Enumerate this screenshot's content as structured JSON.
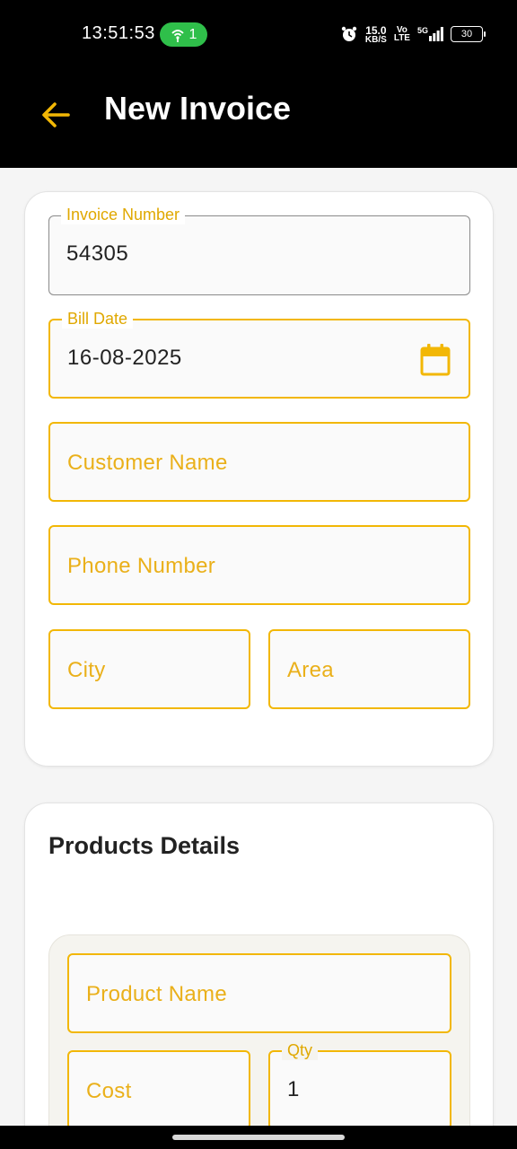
{
  "status_bar": {
    "time": "13:51:53",
    "hotspot_count": "1",
    "net_speed_value": "15.0",
    "net_speed_unit": "KB/S",
    "volte_top": "Vo",
    "volte_bottom": "LTE",
    "signal_label": "5G",
    "battery": "30"
  },
  "app_bar": {
    "title": "New Invoice",
    "accent_color": "#F2B705"
  },
  "invoice_form": {
    "invoice_number": {
      "label": "Invoice Number",
      "value": "54305"
    },
    "bill_date": {
      "label": "Bill Date",
      "value": "16-08-2025"
    },
    "customer_name": {
      "placeholder": "Customer Name",
      "value": ""
    },
    "phone_number": {
      "placeholder": "Phone Number",
      "value": ""
    },
    "city": {
      "placeholder": "City",
      "value": ""
    },
    "area": {
      "placeholder": "Area",
      "value": ""
    }
  },
  "products": {
    "title": "Products Details",
    "items": [
      {
        "product_name": {
          "placeholder": "Product Name",
          "value": ""
        },
        "cost": {
          "placeholder": "Cost",
          "value": ""
        },
        "qty": {
          "label": "Qty",
          "value": "1"
        }
      }
    ]
  },
  "icons": {
    "back": "arrow-left-icon",
    "calendar": "calendar-icon"
  }
}
